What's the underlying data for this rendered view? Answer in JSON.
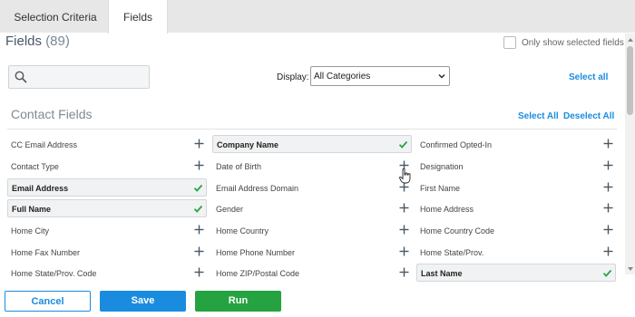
{
  "tabs": [
    {
      "label": "Selection Criteria",
      "active": false
    },
    {
      "label": "Fields",
      "active": true
    }
  ],
  "header": {
    "title": "Fields",
    "count": "(89)",
    "only_selected_label": "Only show selected fields"
  },
  "toolbar": {
    "search_placeholder": "",
    "display_label": "Display:",
    "display_value": "All Categories",
    "select_all_label": "Select all"
  },
  "section": {
    "title": "Contact Fields",
    "select_all_label": "Select All",
    "deselect_all_label": "Deselect All"
  },
  "fields": [
    [
      {
        "label": "CC Email Address",
        "selected": false
      },
      {
        "label": "Contact Type",
        "selected": false
      },
      {
        "label": "Email Address",
        "selected": true
      },
      {
        "label": "Full Name",
        "selected": true
      },
      {
        "label": "Home City",
        "selected": false
      },
      {
        "label": "Home Fax Number",
        "selected": false
      },
      {
        "label": "Home State/Prov. Code",
        "selected": false
      }
    ],
    [
      {
        "label": "Company Name",
        "selected": true
      },
      {
        "label": "Date of Birth",
        "selected": false
      },
      {
        "label": "Email Address Domain",
        "selected": false
      },
      {
        "label": "Gender",
        "selected": false
      },
      {
        "label": "Home Country",
        "selected": false
      },
      {
        "label": "Home Phone Number",
        "selected": false
      },
      {
        "label": "Home ZIP/Postal Code",
        "selected": false
      }
    ],
    [
      {
        "label": "Confirmed Opted-In",
        "selected": false
      },
      {
        "label": "Designation",
        "selected": false
      },
      {
        "label": "First Name",
        "selected": false
      },
      {
        "label": "Home Address",
        "selected": false
      },
      {
        "label": "Home Country Code",
        "selected": false
      },
      {
        "label": "Home State/Prov.",
        "selected": false
      },
      {
        "label": "Last Name",
        "selected": true
      }
    ]
  ],
  "footer": {
    "cancel_label": "Cancel",
    "save_label": "Save",
    "run_label": "Run"
  },
  "colors": {
    "accent": "#1a8cdf",
    "run": "#25a340",
    "check": "#2aa545",
    "plus": "#4a5866"
  },
  "icons": {
    "search": "search-icon",
    "add": "plus-icon",
    "selected": "checkmark-icon",
    "dropdown": "chevron-down-icon",
    "cursor": "hand-pointer-icon"
  }
}
